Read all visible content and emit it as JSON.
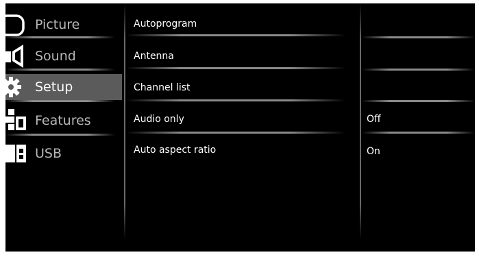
{
  "left_menu": {
    "items": [
      {
        "label": "Picture",
        "icon": "picture-icon"
      },
      {
        "label": "Sound",
        "icon": "speaker-icon"
      },
      {
        "label": "Setup",
        "icon": "gear-icon",
        "active": true
      },
      {
        "label": "Features",
        "icon": "features-icon"
      },
      {
        "label": "USB",
        "icon": "usb-icon"
      }
    ]
  },
  "middle_menu": {
    "items": [
      {
        "label": "Autoprogram"
      },
      {
        "label": "Antenna"
      },
      {
        "label": "Channel list"
      },
      {
        "label": "Audio only"
      },
      {
        "label": "Auto aspect ratio"
      }
    ]
  },
  "values": {
    "audio_only": "Off",
    "auto_aspect_ratio": "On"
  },
  "colors": {
    "background": "#000000",
    "active_highlight": "#5b5b5b",
    "inactive_text": "#b8b8b8",
    "text": "#ffffff"
  }
}
